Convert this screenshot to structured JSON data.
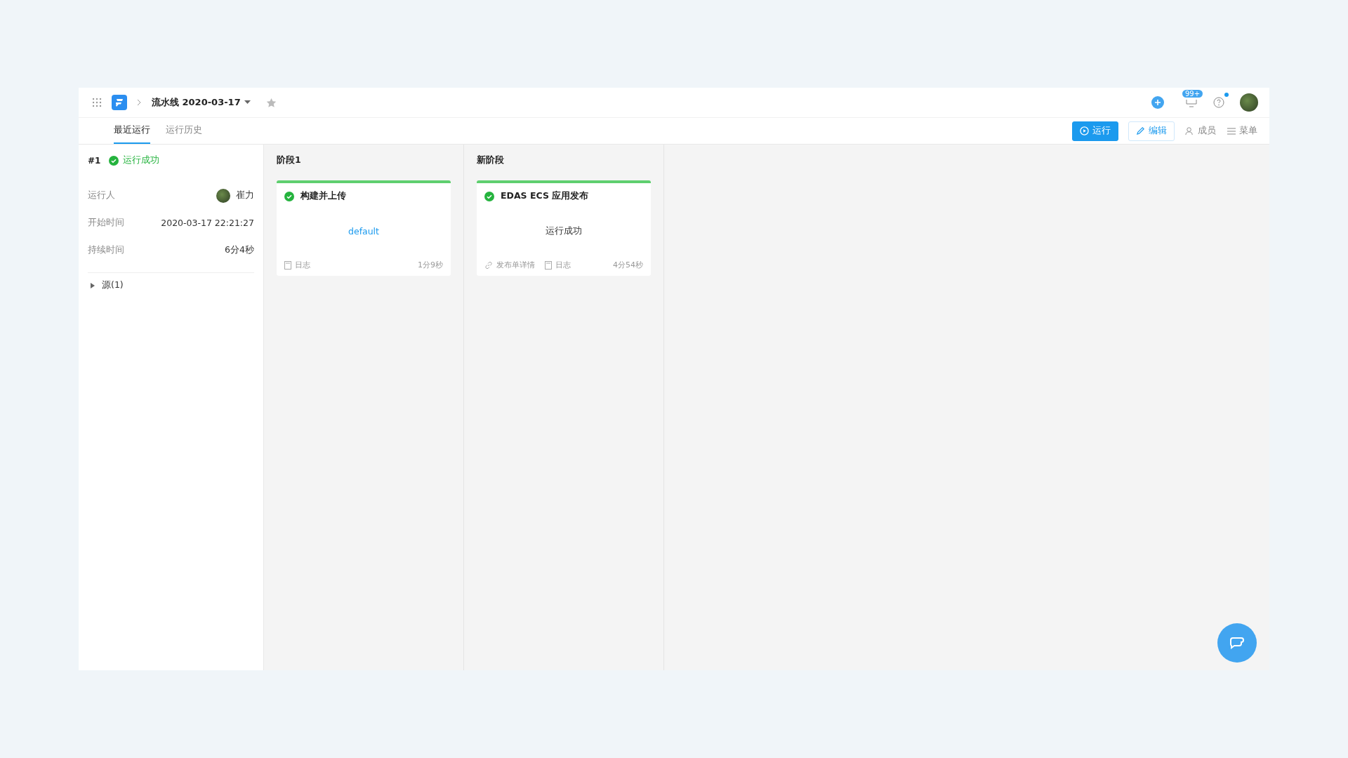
{
  "header": {
    "title": "流水线 2020-03-17",
    "starred": false,
    "notification_badge": "99+",
    "help_dot": true
  },
  "tabs": [
    {
      "label": "最近运行",
      "selected": true
    },
    {
      "label": "运行历史",
      "selected": false
    }
  ],
  "actions": [
    {
      "kind": "run",
      "label": "运行"
    },
    {
      "kind": "edit",
      "label": "编辑"
    },
    {
      "kind": "members",
      "label": "成员"
    },
    {
      "kind": "menu",
      "label": "菜单"
    }
  ],
  "run": {
    "number": "#1",
    "succeeded": true,
    "status_label": "运行成功",
    "fields": [
      {
        "kind": "user",
        "label": "运行人",
        "value": "崔力"
      },
      {
        "kind": "text",
        "label": "开始时间",
        "value": "2020-03-17 22:21:27"
      },
      {
        "kind": "text",
        "label": "持续时间",
        "value": "6分4秒"
      }
    ],
    "sources": {
      "label": "源(1)",
      "expanded": false
    }
  },
  "stages": [
    {
      "name": "阶段1",
      "jobs": [
        {
          "title": "构建并上传",
          "succeeded": true,
          "body": {
            "kind": "link",
            "text": "default"
          },
          "links": [
            {
              "kind": "log",
              "label": "日志"
            }
          ],
          "duration": "1分9秒"
        }
      ]
    },
    {
      "name": "新阶段",
      "jobs": [
        {
          "title": "EDAS ECS 应用发布",
          "succeeded": true,
          "body": {
            "kind": "text",
            "text": "运行成功"
          },
          "links": [
            {
              "kind": "link",
              "label": "发布单详情"
            },
            {
              "kind": "log",
              "label": "日志"
            }
          ],
          "duration": "4分54秒"
        }
      ]
    }
  ]
}
